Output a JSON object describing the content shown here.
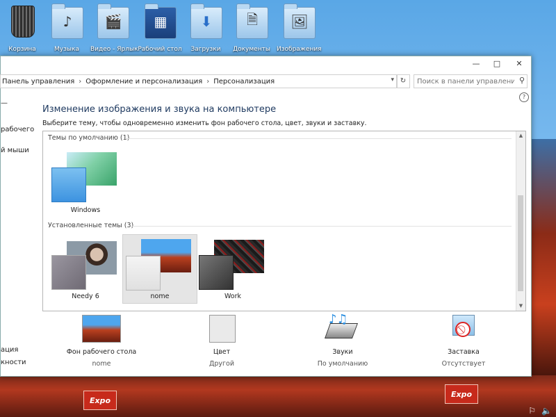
{
  "desktop": {
    "icons": [
      {
        "label": "Корзина",
        "icon": "recycle-bin-icon"
      },
      {
        "label": "Музыка",
        "icon": "music-folder-icon"
      },
      {
        "label": "Видео - Ярлык",
        "icon": "video-folder-icon"
      },
      {
        "label": "Рабочий стол",
        "icon": "desktop-folder-icon"
      },
      {
        "label": "Загрузки",
        "icon": "downloads-folder-icon"
      },
      {
        "label": "Документы",
        "icon": "documents-folder-icon"
      },
      {
        "label": "Изображения",
        "icon": "pictures-folder-icon"
      }
    ],
    "expo_sign": "Expo"
  },
  "window": {
    "controls": {
      "minimize": "—",
      "maximize": "□",
      "close": "✕"
    },
    "breadcrumb": [
      "Панель управления",
      "Оформление и персонализация",
      "Персонализация"
    ],
    "search_placeholder": "Поиск в панели управления",
    "sidebar_fragments": [
      "—",
      "рабочего",
      "й мыши",
      "ация",
      "кности"
    ],
    "title": "Изменение изображения и звука на компьютере",
    "description": "Выберите тему, чтобы одновременно изменить фон рабочего стола, цвет, звуки и заставку.",
    "groups": [
      {
        "heading": "Темы по умолчанию (1)",
        "themes": [
          {
            "name": "Windows",
            "selected": false
          }
        ]
      },
      {
        "heading": "Установленные темы (3)",
        "themes": [
          {
            "name": "Needy 6",
            "selected": false
          },
          {
            "name": "nome",
            "selected": true
          },
          {
            "name": "Work",
            "selected": false
          }
        ]
      }
    ],
    "options": [
      {
        "label": "Фон рабочего стола",
        "value": "nome",
        "icon": "desktop-background-icon"
      },
      {
        "label": "Цвет",
        "value": "Другой",
        "icon": "color-swatch-icon"
      },
      {
        "label": "Звуки",
        "value": "По умолчанию",
        "icon": "sounds-icon"
      },
      {
        "label": "Заставка",
        "value": "Отсутствует",
        "icon": "screensaver-icon"
      }
    ]
  },
  "colors": {
    "title_text": "#1f3a60",
    "selection": "#e5e5e5",
    "desktop_sky": "#78b9ee"
  }
}
